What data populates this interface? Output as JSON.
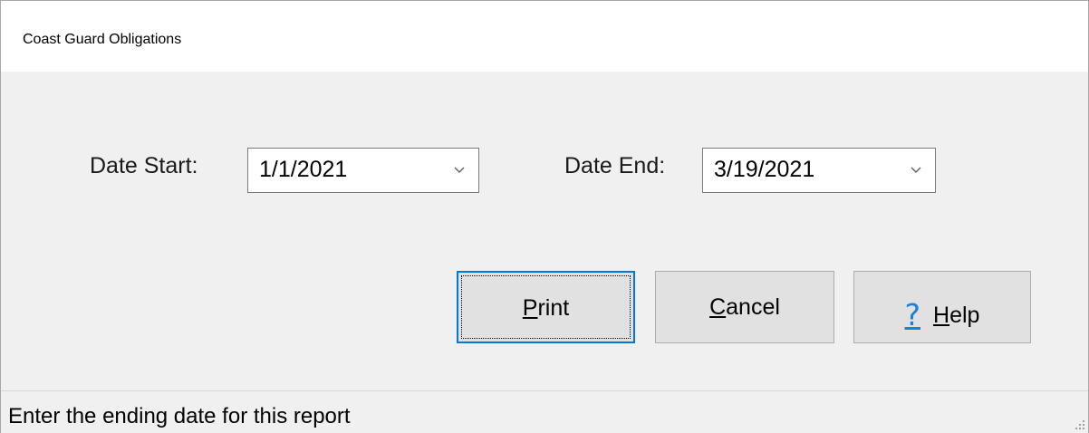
{
  "window": {
    "title": "Coast Guard Obligations"
  },
  "form": {
    "date_start": {
      "label": "Date Start:",
      "value": "1/1/2021"
    },
    "date_end": {
      "label": "Date End:",
      "value": "3/19/2021"
    }
  },
  "buttons": {
    "print": {
      "mnemonic": "P",
      "rest": "rint"
    },
    "cancel": {
      "mnemonic": "C",
      "rest": "ancel"
    },
    "help": {
      "icon_glyph": "?",
      "mnemonic": "H",
      "rest": "elp"
    }
  },
  "icons": {
    "dropdown": "chevron-down-icon",
    "help": "question-mark-icon",
    "resize": "resize-grip-icon"
  },
  "statusbar": {
    "text": "Enter the ending date for this report"
  },
  "colors": {
    "accent": "#0078d7",
    "help_icon": "#1e7fd8",
    "button_face": "#e1e1e1",
    "window_bg": "#f0f0f0"
  }
}
